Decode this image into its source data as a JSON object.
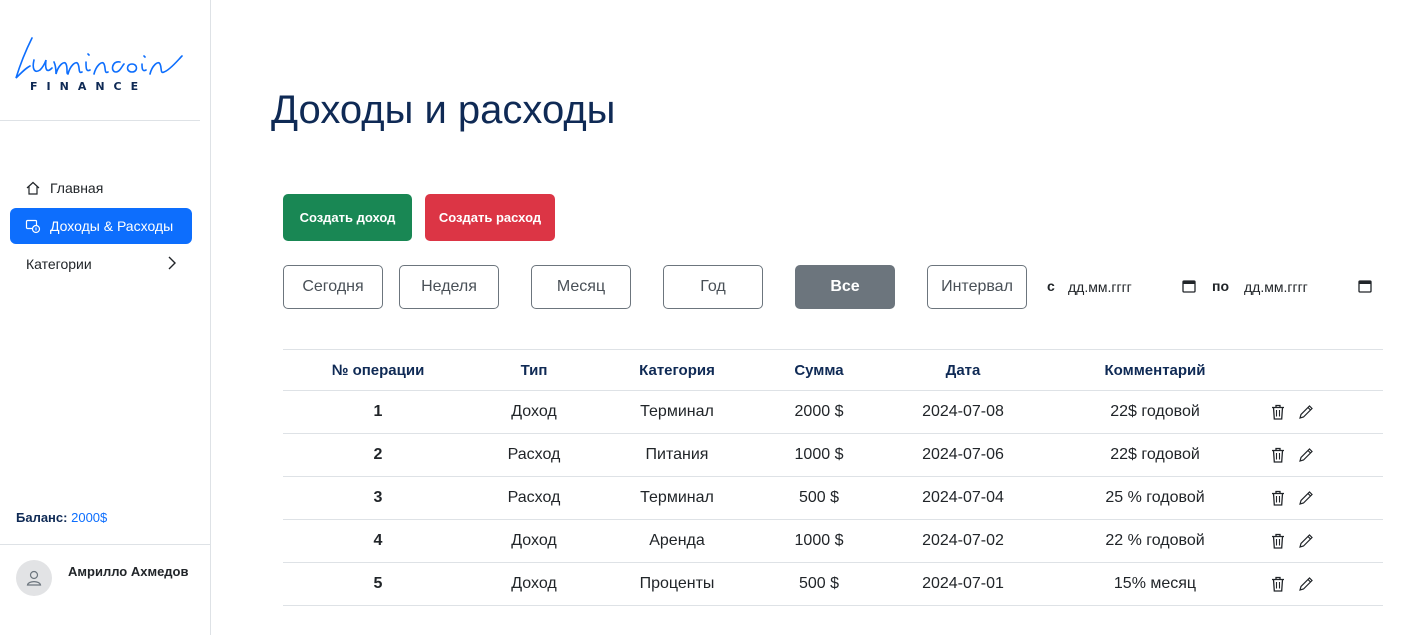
{
  "brand": {
    "script": "Luminсoin",
    "sub": "FINANCE"
  },
  "sidebar": {
    "items": [
      {
        "label": "Главная",
        "icon": "home-icon",
        "active": false
      },
      {
        "label": "Доходы & Расходы",
        "icon": "wallet-icon",
        "active": true
      },
      {
        "label": "Категории",
        "icon": "chevron-right-icon",
        "active": false
      }
    ],
    "balance_label": "Баланс:",
    "balance_value": "2000$",
    "user_name": "Амрилло Ахмедов"
  },
  "main": {
    "title": "Доходы и расходы",
    "create_income": "Создать доход",
    "create_expense": "Создать расход",
    "filters": [
      "Сегодня",
      "Неделя",
      "Месяц",
      "Год",
      "Все",
      "Интервал"
    ],
    "active_filter": "Все",
    "date_from_label": "с",
    "date_to_label": "по",
    "date_placeholder": "дд.мм.гггг"
  },
  "table": {
    "headers": [
      "№ операции",
      "Тип",
      "Категория",
      "Сумма",
      "Дата",
      "Комментарий"
    ],
    "rows": [
      {
        "num": "1",
        "type": "Доход",
        "kind": "income",
        "category": "Терминал",
        "amount": "2000 $",
        "date": "2024-07-08",
        "comment": "22$ годовой"
      },
      {
        "num": "2",
        "type": "Расход",
        "kind": "expense",
        "category": "Питания",
        "amount": "1000 $",
        "date": "2024-07-06",
        "comment": "22$ годовой"
      },
      {
        "num": "3",
        "type": "Расход",
        "kind": "expense",
        "category": "Терминал",
        "amount": "500 $",
        "date": "2024-07-04",
        "comment": "25 % годовой"
      },
      {
        "num": "4",
        "type": "Доход",
        "kind": "income",
        "category": "Аренда",
        "amount": "1000 $",
        "date": "2024-07-02",
        "comment": "22 % годовой"
      },
      {
        "num": "5",
        "type": "Доход",
        "kind": "income",
        "category": "Проценты",
        "amount": "500 $",
        "date": "2024-07-01",
        "comment": "15% месяц"
      }
    ]
  },
  "colors": {
    "primary": "#0d6efd",
    "income": "#198754",
    "expense": "#dc3545",
    "navy": "#0f2a55",
    "secondary": "#6c757d"
  }
}
